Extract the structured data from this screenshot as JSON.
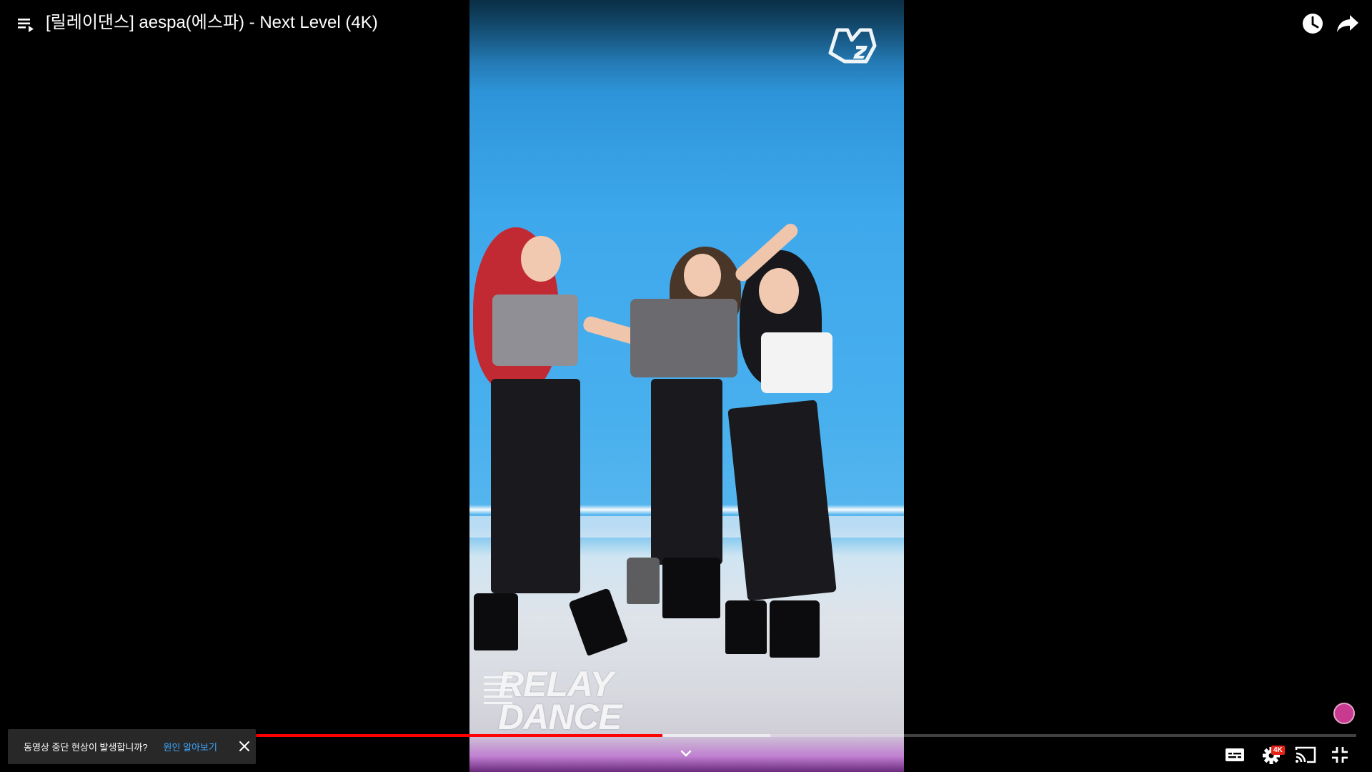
{
  "video": {
    "title": "[릴레이댄스] aespa(에스파) - Next Level (4K)",
    "overlay_line1": "RELAY",
    "overlay_line2": "DANCE",
    "progress_played_fraction": 0.485,
    "progress_buffered_fraction": 0.565
  },
  "notification": {
    "message": "동영상 중단 현상이 발생합니까?",
    "link_label": "원인 알아보기"
  },
  "controls": {
    "quality_badge": "4K"
  },
  "icons": {
    "playlist": "playlist-icon",
    "watch_later": "clock-icon",
    "share": "share-icon",
    "expand": "chevron-down-icon",
    "subtitles": "subtitles-icon",
    "settings": "gear-icon",
    "cast": "cast-icon",
    "exit_fullscreen": "exit-fullscreen-icon",
    "close": "close-icon"
  },
  "colors": {
    "progress_played": "#ff0000",
    "link": "#3ea6ff",
    "quality_badge": "#e62117"
  }
}
